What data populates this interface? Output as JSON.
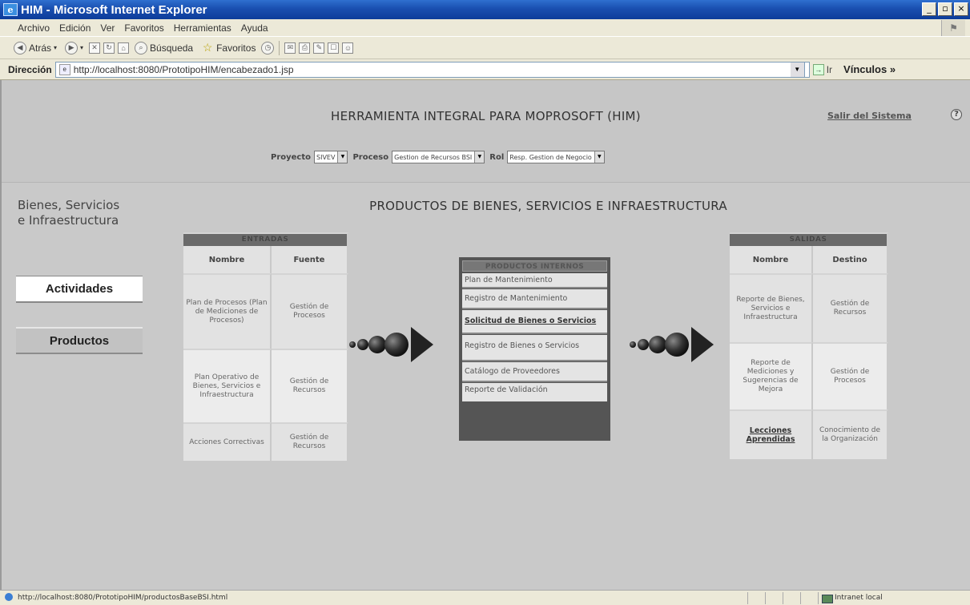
{
  "window": {
    "title": "HIM - Microsoft Internet Explorer",
    "buttons": [
      "_",
      "▫",
      "×"
    ]
  },
  "menubar": [
    "Archivo",
    "Edición",
    "Ver",
    "Favoritos",
    "Herramientas",
    "Ayuda"
  ],
  "toolbar": {
    "back": "Atrás",
    "search": "Búsqueda",
    "favorites": "Favoritos"
  },
  "addressbar": {
    "label": "Dirección",
    "url": "http://localhost:8080/PrototipoHIM/encabezado1.jsp",
    "go": "Ir",
    "links": "Vínculos »"
  },
  "header": {
    "title": "HERRAMIENTA INTEGRAL PARA MOPROSOFT (HIM)",
    "logout": "Salir del Sistema",
    "help": "?"
  },
  "selectors": {
    "proyecto_label": "Proyecto",
    "proyecto_value": "SIVEV",
    "proceso_label": "Proceso",
    "proceso_value": "Gestion de Recursos BSI",
    "rol_label": "Rol",
    "rol_value": "Resp. Gestion de Negocio"
  },
  "sidebar": {
    "title_line1": "Bienes, Servicios",
    "title_line2": "e Infraestructura",
    "actividades": "Actividades",
    "productos": "Productos"
  },
  "main": {
    "title": "PRODUCTOS DE BIENES, SERVICIOS E INFRAESTRUCTURA"
  },
  "entradas": {
    "title": "ENTRADAS",
    "col_nombre": "Nombre",
    "col_fuente": "Fuente",
    "rows": [
      {
        "nombre": "Plan de Procesos (Plan de Mediciones de Procesos)",
        "fuente": "Gestión de Procesos"
      },
      {
        "nombre": "Plan Operativo de Bienes, Servicios e Infraestructura",
        "fuente": "Gestión de Recursos"
      },
      {
        "nombre": "Acciones Correctivas",
        "fuente": "Gestión de Recursos"
      }
    ]
  },
  "internos": {
    "title": "PRODUCTOS INTERNOS",
    "items": [
      "Plan de Mantenimiento",
      "Registro de Mantenimiento",
      "Solicitud de Bienes o Servicios",
      "Registro de Bienes o Servicios",
      "Catálogo de Proveedores",
      "Reporte de Validación"
    ]
  },
  "salidas": {
    "title": "SALIDAS",
    "col_nombre": "Nombre",
    "col_destino": "Destino",
    "rows": [
      {
        "nombre": "Reporte de Bienes, Servicios e Infraestructura",
        "destino": "Gestión de Recursos"
      },
      {
        "nombre": "Reporte de Mediciones y Sugerencias de Mejora",
        "destino": "Gestión de Procesos"
      },
      {
        "nombre": "Lecciones Aprendidas",
        "destino": "Conocimiento de la Organización"
      }
    ]
  },
  "statusbar": {
    "url": "http://localhost:8080/PrototipoHIM/productosBaseBSI.html",
    "zone": "Intranet local"
  }
}
